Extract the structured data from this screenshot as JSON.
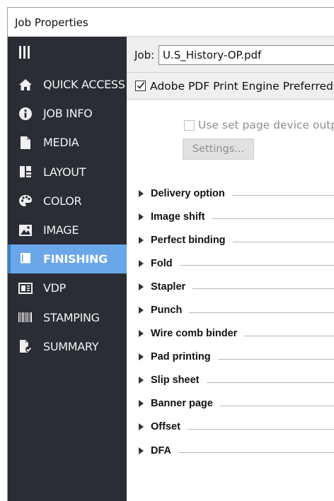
{
  "window": {
    "title": "Job Properties"
  },
  "sidebar": {
    "items": [
      {
        "label": "QUICK ACCESS",
        "icon": "home-icon"
      },
      {
        "label": "JOB INFO",
        "icon": "info-icon"
      },
      {
        "label": "MEDIA",
        "icon": "document-icon"
      },
      {
        "label": "LAYOUT",
        "icon": "layout-icon"
      },
      {
        "label": "COLOR",
        "icon": "palette-icon"
      },
      {
        "label": "IMAGE",
        "icon": "image-icon"
      },
      {
        "label": "FINISHING",
        "icon": "book-icon",
        "active": true
      },
      {
        "label": "VDP",
        "icon": "vdp-icon"
      },
      {
        "label": "STAMPING",
        "icon": "barcode-icon"
      },
      {
        "label": "SUMMARY",
        "icon": "summary-doc-icon"
      }
    ],
    "active_color": "#6aa7e8",
    "background_color": "#2b2d35"
  },
  "job": {
    "label": "Job:",
    "value": "U.S_History-OP.pdf"
  },
  "pdf_engine": {
    "label": "Adobe PDF Print Engine Preferred",
    "checked": true
  },
  "device_output": {
    "label": "Use set page device output",
    "checked": false,
    "disabled": true
  },
  "settings_button": {
    "label": "Settings...",
    "disabled": true
  },
  "sections": [
    "Delivery option",
    "Image shift",
    "Perfect binding",
    "Fold",
    "Stapler",
    "Punch",
    "Wire comb binder",
    "Pad printing",
    "Slip sheet",
    "Banner page",
    "Offset",
    "DFA"
  ]
}
